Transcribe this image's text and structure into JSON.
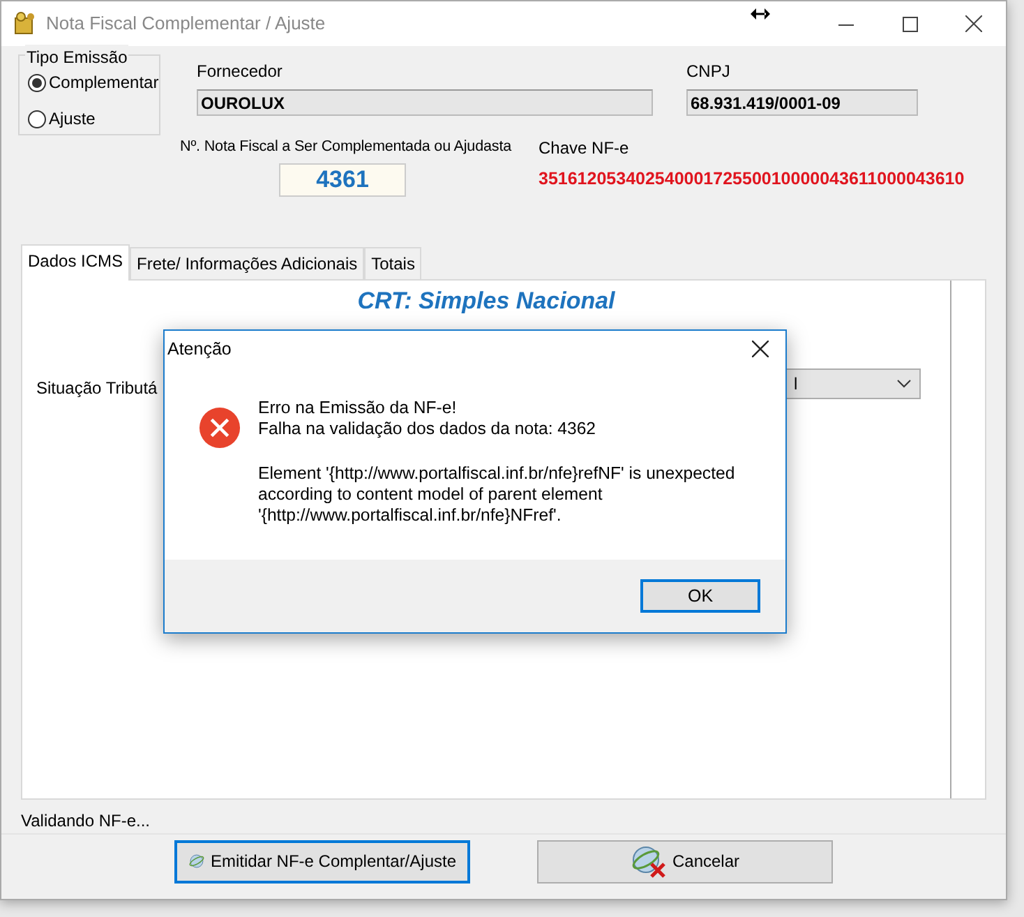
{
  "window": {
    "title": "Nota Fiscal Complementar / Ajuste"
  },
  "tipo_emissao": {
    "label": "Tipo Emissão",
    "options": [
      {
        "label": "Complementar",
        "selected": true
      },
      {
        "label": "Ajuste",
        "selected": false
      }
    ]
  },
  "fornecedor": {
    "label": "Fornecedor",
    "value": "OUROLUX"
  },
  "cnpj": {
    "label": "CNPJ",
    "value": "68.931.419/0001-09"
  },
  "nota_fiscal": {
    "label": "Nº. Nota Fiscal a Ser Complementada ou Ajudasta",
    "value": "4361"
  },
  "chave": {
    "label": "Chave NF-e",
    "value": "35161205340254000172550010000043611000043610"
  },
  "tabs": [
    {
      "label": "Dados ICMS",
      "selected": true
    },
    {
      "label": "Frete/ Informações Adicionais",
      "selected": false
    },
    {
      "label": "Totais",
      "selected": false
    }
  ],
  "crt_title": "CRT: Simples Nacional",
  "situacao": {
    "label": "Situação Tributá",
    "value": "l"
  },
  "status": "Validando NF-e...",
  "buttons": [
    {
      "label": "Emitidar NF-e Complentar/Ajuste",
      "kind": "emit",
      "focused": true
    },
    {
      "label": "Cancelar",
      "kind": "cancel",
      "focused": false
    }
  ],
  "dialog": {
    "title": "Atenção",
    "lines": [
      "Erro na Emissão da NF-e!",
      "Falha na validação dos dados da nota: 4362"
    ],
    "detail": "Element '{http://www.portalfiscal.inf.br/nfe}refNF' is unexpected according to content model of parent element '{http://www.portalfiscal.inf.br/nfe}NFref'.",
    "button": "OK"
  }
}
